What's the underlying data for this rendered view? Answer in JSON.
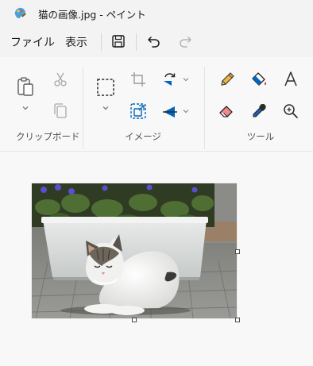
{
  "window": {
    "title": "猫の画像.jpg - ペイント"
  },
  "menu": {
    "file": "ファイル",
    "view": "表示"
  },
  "ribbon": {
    "groups": {
      "clipboard": "クリップボード",
      "image": "イメージ",
      "tools": "ツール"
    }
  },
  "colors": {
    "accent": "#0067c0",
    "pencil": "#e8a22a",
    "eraser": "#f08a8a",
    "picker": "#1a5fb4"
  },
  "icons": [
    "paint-app-icon",
    "save-icon",
    "undo-icon",
    "redo-icon",
    "paste-icon",
    "cut-icon",
    "copy-icon",
    "select-icon",
    "crop-icon",
    "resize-icon",
    "rotate-icon",
    "flip-icon",
    "pencil-icon",
    "fill-icon",
    "text-icon",
    "eraser-icon",
    "color-picker-icon",
    "magnifier-icon"
  ]
}
